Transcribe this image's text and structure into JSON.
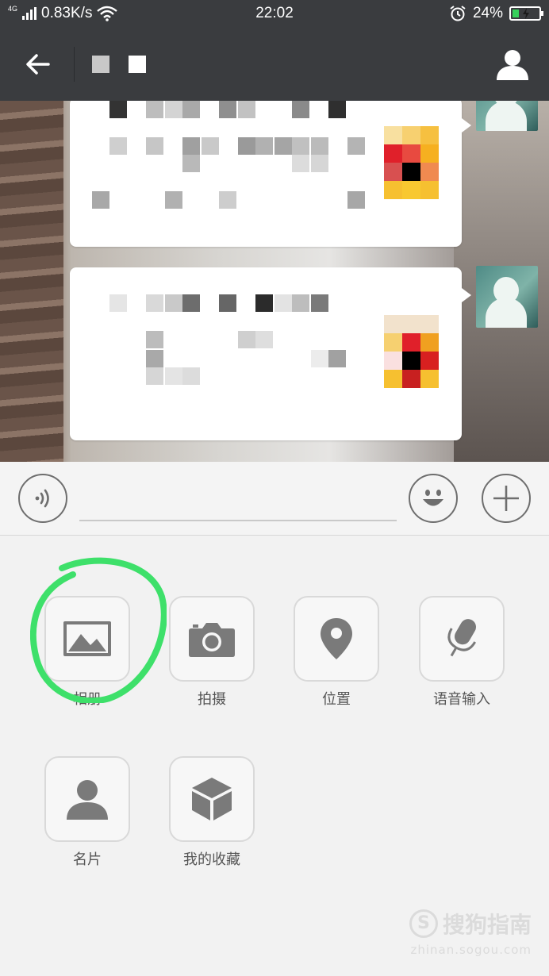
{
  "status_bar": {
    "network": "4G",
    "speed": "0.83K/s",
    "time": "22:02",
    "battery": "24%",
    "battery_level": 0.24
  },
  "header": {
    "back_icon": "arrow-left-icon",
    "profile_icon": "person-icon"
  },
  "input_bar": {
    "voice_icon": "voice-icon",
    "text_value": "",
    "emoji_icon": "smiley-icon",
    "more_icon": "plus-icon"
  },
  "panel": {
    "items": [
      {
        "label": "相册",
        "icon": "image-icon"
      },
      {
        "label": "拍摄",
        "icon": "camera-icon"
      },
      {
        "label": "位置",
        "icon": "location-pin-icon"
      },
      {
        "label": "语音输入",
        "icon": "microphone-icon"
      },
      {
        "label": "名片",
        "icon": "contact-card-icon"
      },
      {
        "label": "我的收藏",
        "icon": "cube-icon"
      }
    ]
  },
  "colors": {
    "bar_bg": "#3a3c3f",
    "panel_bg": "#f2f2f2",
    "icon_gray": "#7a7a7a",
    "highlight_green": "#3ee06a",
    "battery_green": "#35d05a"
  },
  "watermark": {
    "main": "搜狗指南",
    "sub": "zhinan.sogou.com"
  }
}
